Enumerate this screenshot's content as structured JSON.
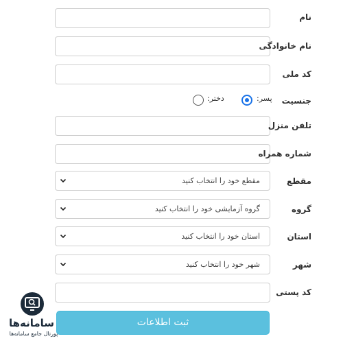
{
  "form": {
    "name_label": "نام",
    "family_label": "نام خانوادگی",
    "national_code_label": "کد ملی",
    "gender_label": "جنسیت",
    "gender_male_label": "پسر:",
    "gender_female_label": "دختر:",
    "gender_selected": "male",
    "home_phone_label": "تلفن منزل",
    "mobile_label": "شماره همراه",
    "grade_label": "مقطع",
    "grade_placeholder": "مقطع خود را انتخاب کنید",
    "group_label": "گروه",
    "group_placeholder": "گروه آزمایشی خود را انتخاب کنید",
    "province_label": "استان",
    "province_placeholder": "استان خود را انتخاب کنید",
    "city_label": "شهر",
    "city_placeholder": "شهر خود را انتخاب کنید",
    "postal_code_label": "کد پستی",
    "submit_label": "ثبت اطلاعات"
  },
  "watermark": {
    "title": "سامانه‌ها",
    "subtitle": "پورتال جامع سامانه‌ها"
  },
  "colors": {
    "accent": "#1a73e8",
    "submit_bg": "#5bc0de",
    "logo": "#1c2b3a"
  }
}
